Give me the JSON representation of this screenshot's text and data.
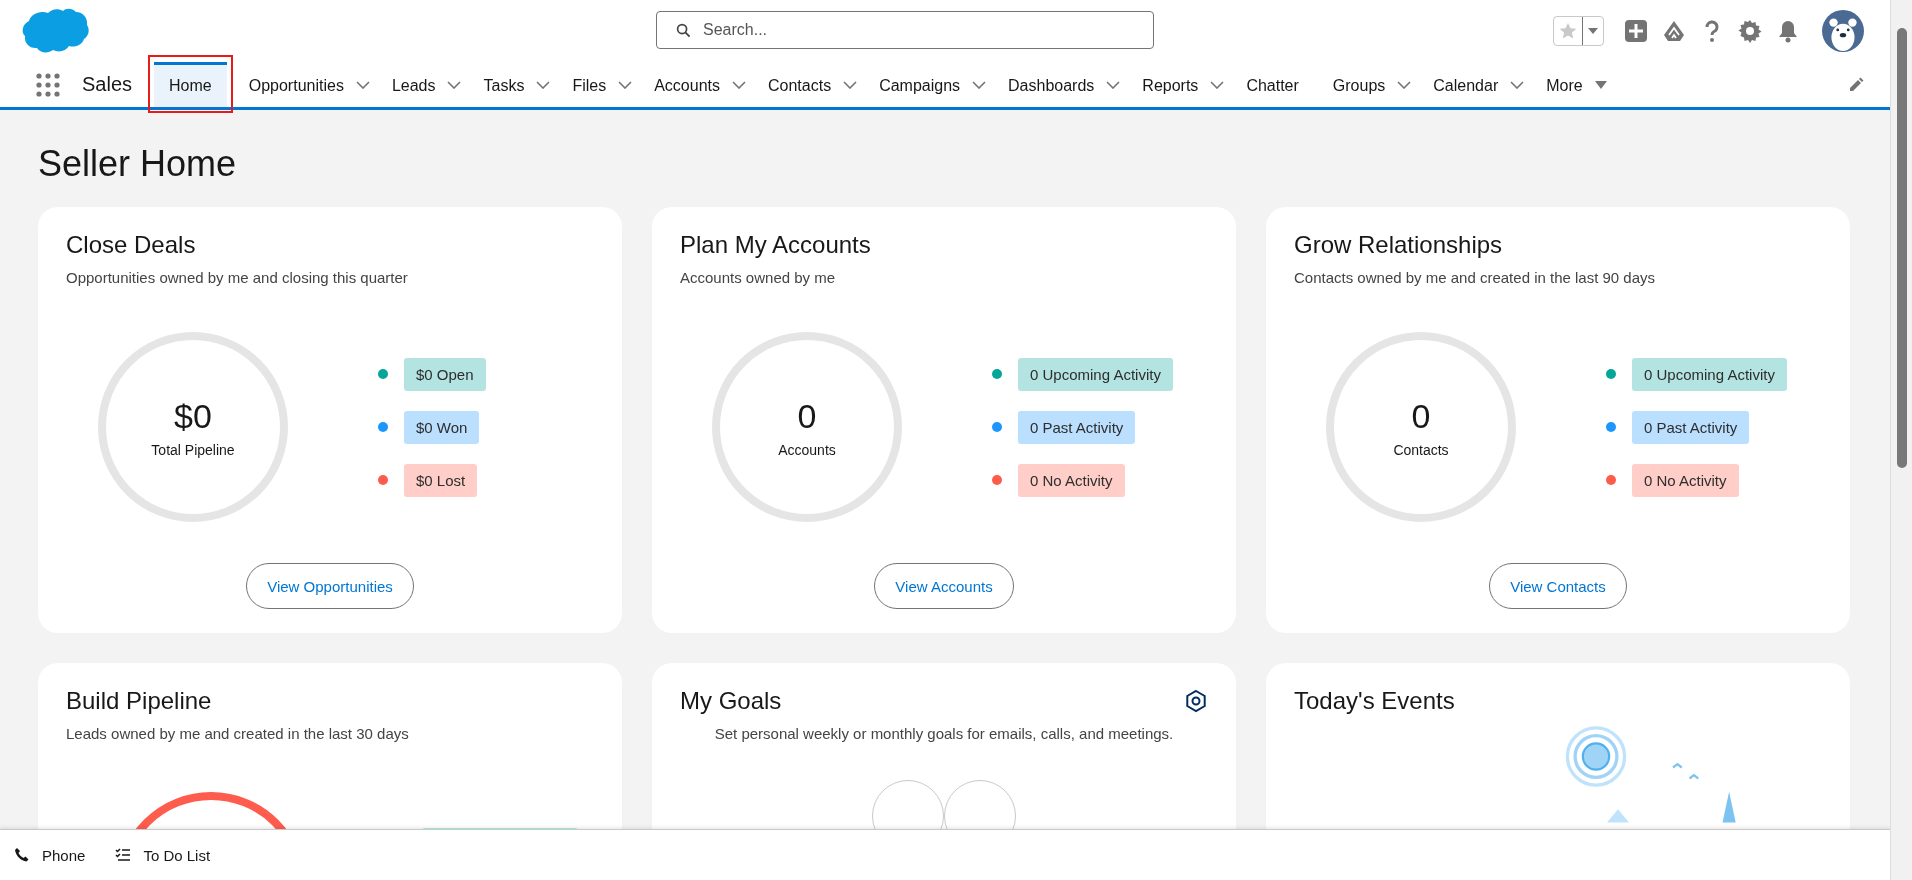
{
  "app": {
    "name": "Sales"
  },
  "search": {
    "placeholder": "Search..."
  },
  "nav": [
    {
      "label": "Home",
      "selected": true,
      "kind": "plain",
      "highlighted": true
    },
    {
      "label": "Opportunities",
      "selected": false,
      "kind": "dropdown",
      "highlighted": false
    },
    {
      "label": "Leads",
      "selected": false,
      "kind": "dropdown",
      "highlighted": false
    },
    {
      "label": "Tasks",
      "selected": false,
      "kind": "dropdown",
      "highlighted": false
    },
    {
      "label": "Files",
      "selected": false,
      "kind": "dropdown",
      "highlighted": false
    },
    {
      "label": "Accounts",
      "selected": false,
      "kind": "dropdown",
      "highlighted": false
    },
    {
      "label": "Contacts",
      "selected": false,
      "kind": "dropdown",
      "highlighted": false
    },
    {
      "label": "Campaigns",
      "selected": false,
      "kind": "dropdown",
      "highlighted": false
    },
    {
      "label": "Dashboards",
      "selected": false,
      "kind": "dropdown",
      "highlighted": false
    },
    {
      "label": "Reports",
      "selected": false,
      "kind": "dropdown",
      "highlighted": false
    },
    {
      "label": "Chatter",
      "selected": false,
      "kind": "plain",
      "highlighted": false
    },
    {
      "label": "Groups",
      "selected": false,
      "kind": "dropdown",
      "highlighted": false
    },
    {
      "label": "Calendar",
      "selected": false,
      "kind": "dropdown",
      "highlighted": false
    },
    {
      "label": "More",
      "selected": false,
      "kind": "more",
      "highlighted": false
    }
  ],
  "page": {
    "title": "Seller Home"
  },
  "summary_cards": [
    {
      "title": "Close Deals",
      "subtitle": "Opportunities owned by me and closing this quarter",
      "value": "$0",
      "value_label": "Total Pipeline",
      "button": "View Opportunities",
      "legend": [
        {
          "label": "$0 Open",
          "color": "#06a59a"
        },
        {
          "label": "$0 Won",
          "color": "#1b96ff"
        },
        {
          "label": "$0 Lost",
          "color": "#fe5c4c"
        }
      ]
    },
    {
      "title": "Plan My Accounts",
      "subtitle": "Accounts owned by me",
      "value": "0",
      "value_label": "Accounts",
      "button": "View Accounts",
      "legend": [
        {
          "label": "0 Upcoming Activity",
          "color": "#06a59a"
        },
        {
          "label": "0 Past Activity",
          "color": "#1b96ff"
        },
        {
          "label": "0 No Activity",
          "color": "#fe5c4c"
        }
      ]
    },
    {
      "title": "Grow Relationships",
      "subtitle": "Contacts owned by me and created in the last 90 days",
      "value": "0",
      "value_label": "Contacts",
      "button": "View Contacts",
      "legend": [
        {
          "label": "0 Upcoming Activity",
          "color": "#06a59a"
        },
        {
          "label": "0 Past Activity",
          "color": "#1b96ff"
        },
        {
          "label": "0 No Activity",
          "color": "#fe5c4c"
        }
      ]
    }
  ],
  "lower_cards": [
    {
      "kind": "pipeline",
      "title": "Build Pipeline",
      "subtitle": "Leads owned by me and created in the last 30 days"
    },
    {
      "kind": "goals",
      "title": "My Goals",
      "subtitle": "Set personal weekly or monthly goals for emails, calls, and meetings."
    },
    {
      "kind": "events",
      "title": "Today's Events"
    }
  ],
  "utility_bar": [
    {
      "label": "Phone",
      "kind": "phone"
    },
    {
      "label": "To Do List",
      "kind": "todo"
    }
  ]
}
